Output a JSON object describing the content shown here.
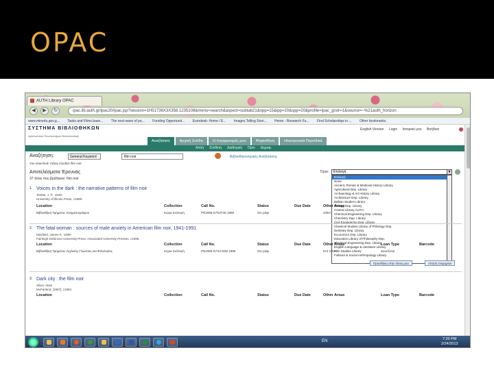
{
  "slide": {
    "title": "OPAC"
  },
  "browser": {
    "tab_title": "AUTH Library OPAC",
    "url": "ipac.lib.auth.gr/ipac20/ipac.jsp?session=1H51736X3X358.1235108&menu=search&aspect=subtab21&npp=15&ipp=20&spp=20&profile=ipac_grstr=1&source=~%21auth_horizon",
    "bookmarks": [
      "www.minedu.gov.g...",
      "Tasks and Films base...",
      "The next wave of po...",
      "Funding Opportunit...",
      "Eurodesk: Home / E...",
      "Images Telling Stori...",
      "Home - Research Fu...",
      "Find Scholarships in ...",
      "Other bookmarks"
    ]
  },
  "opac": {
    "logo": "ΣΥΣΤΗΜΑ ΒΙΒΛΙΟΘΗΚΩΝ",
    "logo_sub": "Αριστοτέλειο Πανεπιστήμιο Θεσσαλονίκης",
    "top_links": [
      "English Version",
      "Login",
      "Ιστορικό μου",
      "Βοήθεια"
    ],
    "menu": [
      "Αναζήτηση",
      "Αρχική Σελίδα",
      "Ο Λογαριασμός μου",
      "Ψηφιοθήκη",
      "Ηλεκτρονικά Περιοδικά"
    ],
    "subnav": [
      "Απλή",
      "Σύνθετη",
      "Διαδοχική",
      "Όροι",
      "Δημοφ."
    ],
    "search_label": "Αναζήτηση:",
    "search_type": "General Keyword",
    "search_value": "film noir",
    "advanced_link": "Βιβλιοθηκονομικές Αναζητήσεις",
    "session_note": "You searched: Λέξεις Κλειδιά: film noir",
    "results_title": "Αποτελέσματα Έρευνας",
    "results_count": "37 τίτλοι που βρέθηκαν: film noir",
    "filter_label": "Όρια:",
    "filter_value": "Επιλογή",
    "filter_options": [
      "Επιλογή",
      "None",
      "Ancient, Roman & Medieval History Library",
      "Agricultural Dep. Library",
      "Archaeology & Art History Library",
      "Architecture Dep. Library",
      "Balkan Studies Library",
      "Biology Dep. Library",
      "Central Library AUTH",
      "Chemical Engineering Dep. Library",
      "Chemistry Dep. Library",
      "Civil Engineering Dep. Library",
      "Classical Studies Library of Philology Dep.",
      "Dentistry Dep. Library",
      "Economics Dep. Library",
      "Education Library of Philosophy Dep.",
      "Electrical Engineering Dep. Library",
      "English Language & Literature Library",
      "Film Studies Library",
      "Folklore & Social Anthropology Library"
    ],
    "records": [
      {
        "num": "1.",
        "title": "Voices in the dark : the narrative patterns of film noir",
        "meta1": "Telotte, J. P., 1949-",
        "meta2": "University of Illinois Press, c1989.",
        "headers": [
          "Location",
          "Collection",
          "Call No.",
          "Status",
          "Due Date",
          "Other Areas"
        ],
        "row": [
          "Βιβλιοθήκη Τμήματος Κινηματογράφου",
          "Κύρια Συλλογή",
          "PN1995.9.F54T45 1989",
          "Στο ράφι",
          "",
          "Other"
        ]
      },
      {
        "num": "2.",
        "title": "The fatal woman : sources of male anxiety in American film noir, 1941-1991",
        "meta1": "Maxfield, James F., 1939-",
        "meta2": "Fairleigh Dickinson University Press; Associated University Presses, c1996.",
        "headers": [
          "Location",
          "Collection",
          "Call No.",
          "Status",
          "Due Date",
          "Other Areas",
          "Loan Type",
          "Barcode"
        ],
        "row": [
          "Βιβλιοθήκη Τμήματος Αγγλικής Γλώσσας και Φιλολογίας",
          "Κύρια Συλλογή",
          "PN1995.9.F44 M38 1996",
          "Στο ράφι",
          "",
          "Επί τόπου",
          "Δανείζεται",
          ""
        ],
        "btn_add": "Προσθήκη στην λίστα μου",
        "btn_request": "Αίτηση τεκμηρίου"
      },
      {
        "num": "3.",
        "title": "Dark city : the film noir",
        "meta1": "Silver, Alain",
        "meta2": "McFarland, [1987], c1984",
        "headers": [
          "Location",
          "Collection",
          "Call No.",
          "Status",
          "Due Date",
          "Other Areas",
          "Loan Type",
          "Barcode"
        ]
      }
    ]
  },
  "taskbar": {
    "lang": "EN",
    "time": "7:20 PM",
    "date": "2/24/2013"
  }
}
